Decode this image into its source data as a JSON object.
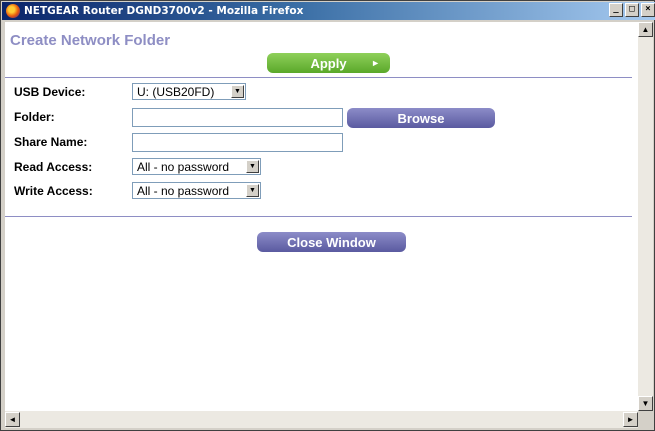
{
  "window": {
    "title": "NETGEAR Router DGND3700v2 - Mozilla Firefox",
    "controls": [
      "_",
      "□",
      "×"
    ]
  },
  "page": {
    "title": "Create Network Folder",
    "apply_label": "Apply",
    "apply_arrow": "►",
    "browse_label": "Browse",
    "close_label": "Close Window"
  },
  "form": {
    "usb_device": {
      "label": "USB Device:",
      "value": "U: (USB20FD)"
    },
    "folder": {
      "label": "Folder:",
      "value": ""
    },
    "share_name": {
      "label": "Share Name:",
      "value": ""
    },
    "read_access": {
      "label": "Read Access:",
      "value": "All - no password"
    },
    "write_access": {
      "label": "Write Access:",
      "value": "All - no password"
    }
  },
  "icons": {
    "window_icon": "firefox-icon",
    "dropdown": "chevron-down-icon"
  },
  "colors": {
    "title": "#8e8ec4",
    "apply_button": "#6cba3a",
    "purple_button": "#6e6eb0",
    "divider": "#8e8ec4"
  }
}
